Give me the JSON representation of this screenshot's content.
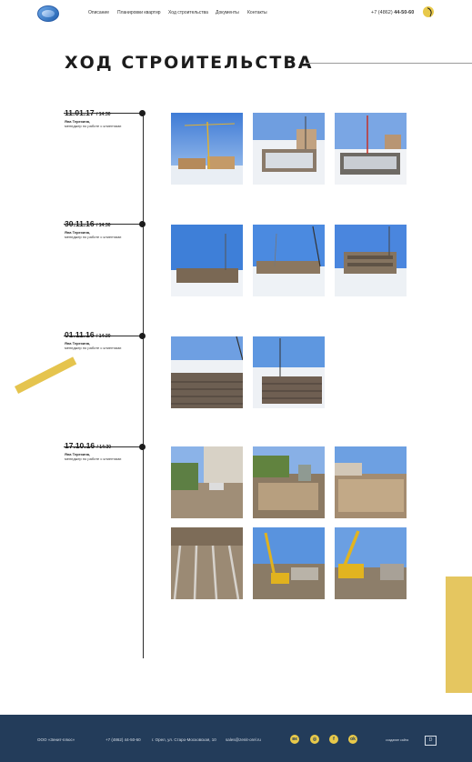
{
  "header": {
    "nav": [
      "Описание",
      "Планировки квартир",
      "Ход строительства",
      "Документы",
      "Контакты"
    ],
    "phone_prefix": "+7 (4862) ",
    "phone_main": "44-50-60"
  },
  "page_title": "ХОД СТРОИТЕЛЬСТВА",
  "entries": [
    {
      "date": "11.01.17",
      "time": "/ 14:30",
      "author": "Яна Терехина,",
      "role": "менеджер по работе с клиентами"
    },
    {
      "date": "30.11.16",
      "time": "/ 14:30",
      "author": "Яна Терехина,",
      "role": "менеджер по работе с клиентами"
    },
    {
      "date": "01.11.16",
      "time": "/ 14:30",
      "author": "Яна Терехина,",
      "role": "менеджер по работе с клиентами"
    },
    {
      "date": "17.10.16",
      "time": "/ 14:30",
      "author": "Яна Терехина,",
      "role": "менеджер по работе с клиентами"
    }
  ],
  "footer": {
    "company": "ООО «Зенит-плюс»",
    "phone": "+7 (4862) 44-50-60",
    "address": "г. Орел, ул. Старо-Московская, 10",
    "email": "sales@zenit-orel.ru",
    "social": [
      "vk-icon",
      "instagram-icon",
      "facebook-icon",
      "odnoklassniki-icon"
    ],
    "social_glyphs": [
      "вк",
      "◎",
      "f",
      "ok"
    ],
    "dev_label": "создание сайта"
  },
  "colors": {
    "accent": "#e5c44e",
    "footer": "#233c5a",
    "text": "#1c1c1c"
  }
}
